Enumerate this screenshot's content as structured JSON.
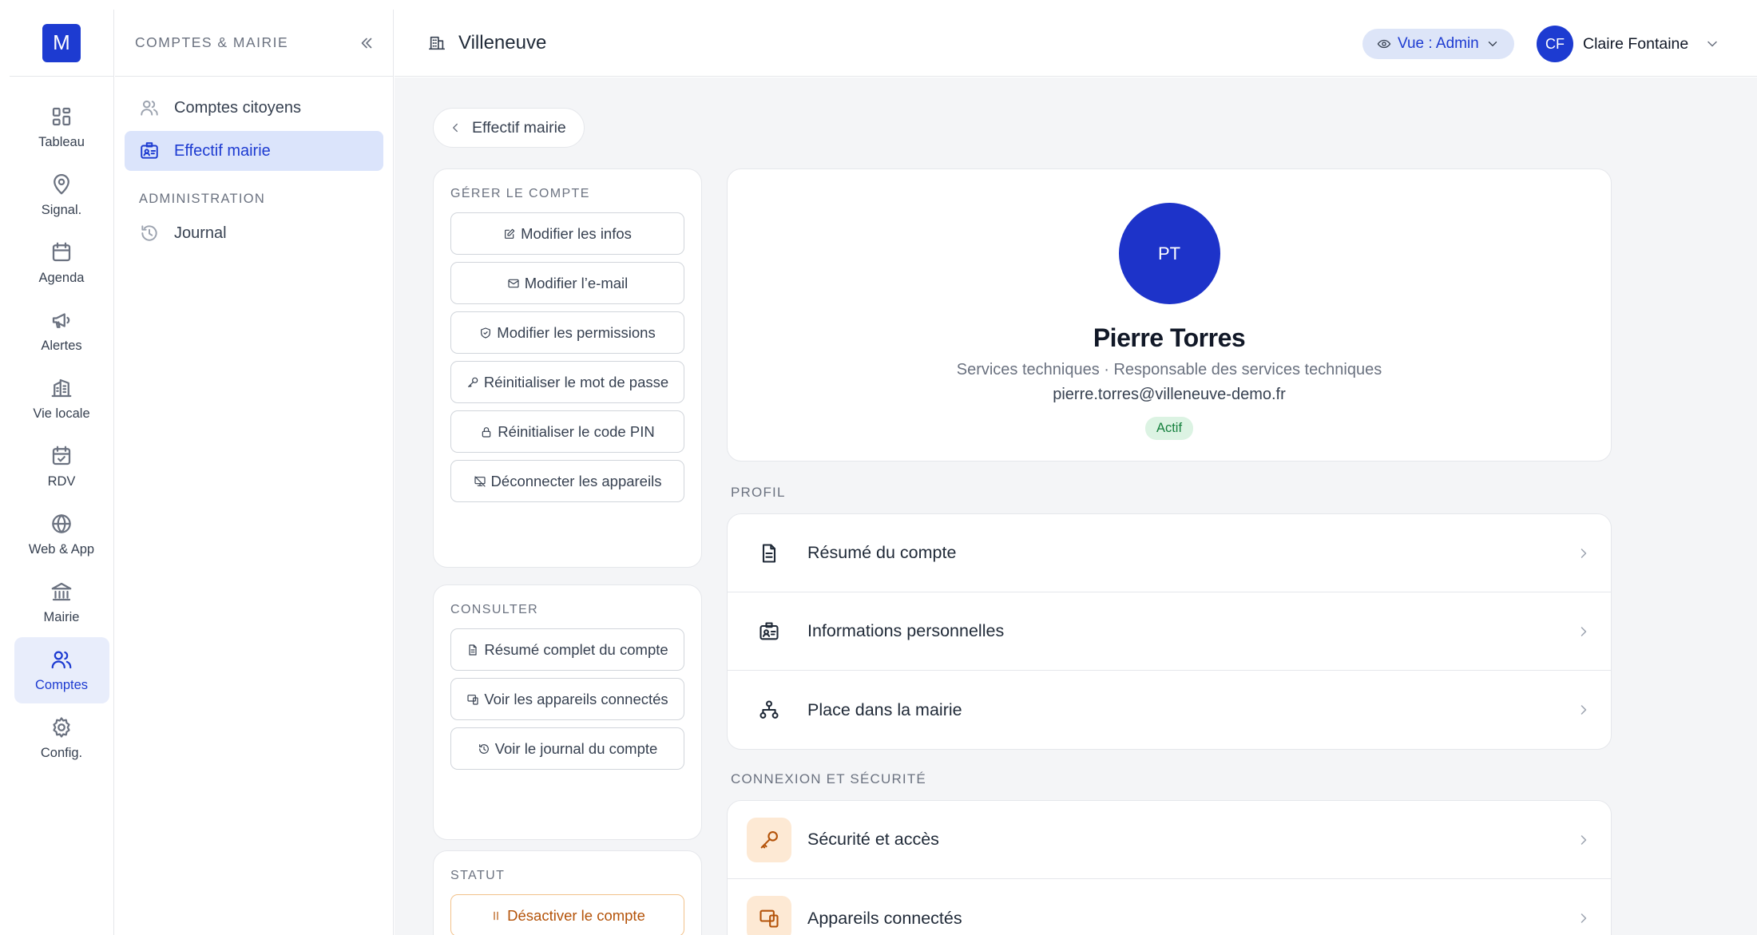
{
  "app": {
    "logo_letter": "M"
  },
  "rail": [
    {
      "label": "Tableau",
      "icon": "dashboard-icon"
    },
    {
      "label": "Signal.",
      "icon": "map-pin-icon"
    },
    {
      "label": "Agenda",
      "icon": "calendar-icon"
    },
    {
      "label": "Alertes",
      "icon": "megaphone-icon"
    },
    {
      "label": "Vie locale",
      "icon": "building-icon"
    },
    {
      "label": "RDV",
      "icon": "calendar-check-icon"
    },
    {
      "label": "Web & App",
      "icon": "globe-icon"
    },
    {
      "label": "Mairie",
      "icon": "town-hall-icon"
    },
    {
      "label": "Comptes",
      "icon": "users-icon",
      "active": true
    },
    {
      "label": "Config.",
      "icon": "gear-icon"
    }
  ],
  "subnav": {
    "title": "COMPTES & MAIRIE",
    "items": [
      {
        "label": "Comptes citoyens",
        "icon": "users-icon"
      },
      {
        "label": "Effectif mairie",
        "icon": "id-card-icon",
        "active": true
      }
    ],
    "section": "ADMINISTRATION",
    "section_items": [
      {
        "label": "Journal",
        "icon": "history-icon"
      }
    ]
  },
  "header": {
    "city": "Villeneuve",
    "view_label": "Vue : Admin",
    "user_initials": "CF",
    "user_name": "Claire Fontaine"
  },
  "main": {
    "back_label": "Effectif mairie",
    "manage": {
      "title": "GÉRER LE COMPTE",
      "actions": [
        "Modifier les infos",
        "Modifier l’e-mail",
        "Modifier les permissions",
        "Réinitialiser le mot de passe",
        "Réinitialiser le code PIN",
        "Déconnecter les appareils"
      ]
    },
    "consult": {
      "title": "CONSULTER",
      "actions": [
        "Résumé complet du compte",
        "Voir les appareils connectés",
        "Voir le journal du compte"
      ]
    },
    "status": {
      "title": "STATUT",
      "action": "Désactiver le compte"
    },
    "profile": {
      "initials": "PT",
      "name": "Pierre Torres",
      "role": "Services techniques · Responsable des services techniques",
      "email": "pierre.torres@villeneuve-demo.fr",
      "status": "Actif"
    },
    "profile_section": {
      "title": "PROFIL",
      "items": [
        "Résumé du compte",
        "Informations personnelles",
        "Place dans la mairie"
      ]
    },
    "security_section": {
      "title": "CONNEXION ET SÉCURITÉ",
      "items": [
        "Sécurité et accès",
        "Appareils connectés"
      ]
    }
  },
  "colors": {
    "accent": "#1d3bd1",
    "success": "#15803d",
    "warning": "#b45309"
  }
}
